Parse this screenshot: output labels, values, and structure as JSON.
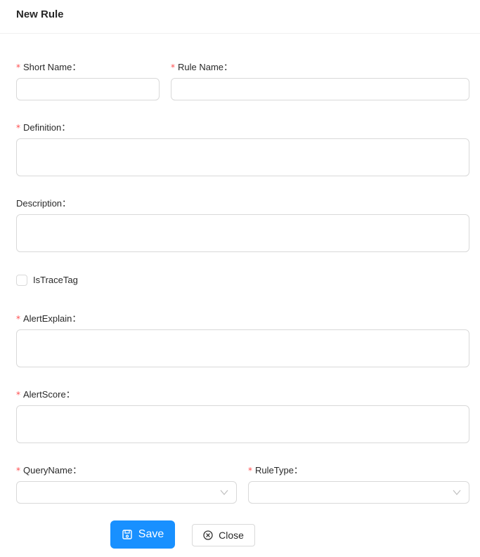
{
  "header": {
    "title": "New Rule"
  },
  "form": {
    "short_name": {
      "label": "Short Name：",
      "required": true,
      "value": ""
    },
    "rule_name": {
      "label": "Rule Name：",
      "required": true,
      "value": ""
    },
    "definition": {
      "label": "Definition：",
      "required": true,
      "value": ""
    },
    "description": {
      "label": "Description：",
      "required": false,
      "value": ""
    },
    "is_trace_tag": {
      "label": "IsTraceTag",
      "checked": false
    },
    "alert_explain": {
      "label": "AlertExplain：",
      "required": true,
      "value": ""
    },
    "alert_score": {
      "label": "AlertScore：",
      "required": true,
      "value": ""
    },
    "query_name": {
      "label": "QueryName：",
      "required": true,
      "selected": ""
    },
    "rule_type": {
      "label": "RuleType：",
      "required": true,
      "selected": ""
    },
    "required_mark": "*"
  },
  "actions": {
    "save_label": "Save",
    "close_label": "Close",
    "save_icon": "save-icon",
    "close_icon": "close-circle-icon"
  },
  "colors": {
    "primary": "#1890ff",
    "required": "#ff4d4f",
    "border": "#d9d9d9"
  }
}
